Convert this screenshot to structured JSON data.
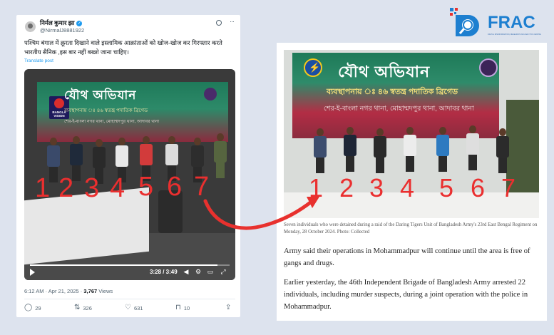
{
  "tweet": {
    "display_name": "निर्मल कुमार झा",
    "handle": "@NirmalJ8881922",
    "text": "पश्चिम बंगाल में क्रूरता दिखाने वाले इस्लामिक आक्रांताओं को खोज-खोज कर गिरफ्तार करते भारतीय सैनिक ,इस बार नहीं बख्शे जाना चाहिए।",
    "translate_label": "Translate post",
    "video": {
      "banner_title": "যৌথ অভিযান",
      "banner_sub": "ব্যবস্থাপনায় ঃ ৪৬ স্বতন্ত্র পদাতিক ব্রিগেড",
      "banner_sub2": "শের-ই-বাংলা নগর থানা, মোহাম্মদপুর থানা, আদাবর থানা",
      "badge_text": "BANGLA VISION",
      "numbers": [
        "1",
        "2",
        "3",
        "4",
        "5",
        "6",
        "7"
      ],
      "time": "3:28 / 3:49",
      "progress": 0.94
    },
    "meta": {
      "timestamp": "6:12 AM · Apr 21, 2025 · ",
      "views_count": "3,767",
      "views_label": " Views"
    },
    "actions": {
      "replies": "29",
      "reposts": "326",
      "likes": "631",
      "bookmarks": "10"
    }
  },
  "article": {
    "photo": {
      "banner_title": "যৌথ অভিযান",
      "banner_sub": "ব্যবস্থাপনায় ঃ ৪৬ স্বতন্ত্র পদাতিক ব্রিগেড",
      "banner_sub2": "শের-ই-বাংলা নগর থানা, মোহাম্মদপুর থানা, আদাবর থানা",
      "numbers": [
        "1",
        "2",
        "3",
        "4",
        "5",
        "6",
        "7"
      ]
    },
    "caption": "Seven individuals who were detained during a raid of the Daring Tigers Unit of Bangladesh Army's 23rd East Bengal Regiment on Monday, 28 October 2024. Photo: Collected",
    "para1": "Army said their operations in Mohammadpur will continue until the area is free of gangs and drugs.",
    "para2": "Earlier yesterday, the 46th Independent Brigade of Bangladesh Army arrested 22 individuals, including murder suspects, during a joint operation with the police in Mohammadpur."
  },
  "logo": {
    "text": "FRAC",
    "tagline": "DIGITAL MISINFORMATION, RESEARCH AND ANALYTICS CENTRE"
  },
  "colors": {
    "number_red": "#ea2f2f",
    "arrow_red": "#e8312e",
    "logo_blue": "#1d7fd0",
    "logo_red": "#e8312e"
  },
  "icons": {
    "verified": "verified-badge-icon",
    "grok": "grok-icon",
    "more": "more-icon",
    "play": "play-icon",
    "volume": "volume-icon",
    "settings": "settings-icon",
    "pip": "pip-icon",
    "fullscreen": "fullscreen-icon",
    "reply": "reply-icon",
    "repost": "repost-icon",
    "like": "like-icon",
    "bookmark": "bookmark-icon",
    "share": "share-icon"
  }
}
